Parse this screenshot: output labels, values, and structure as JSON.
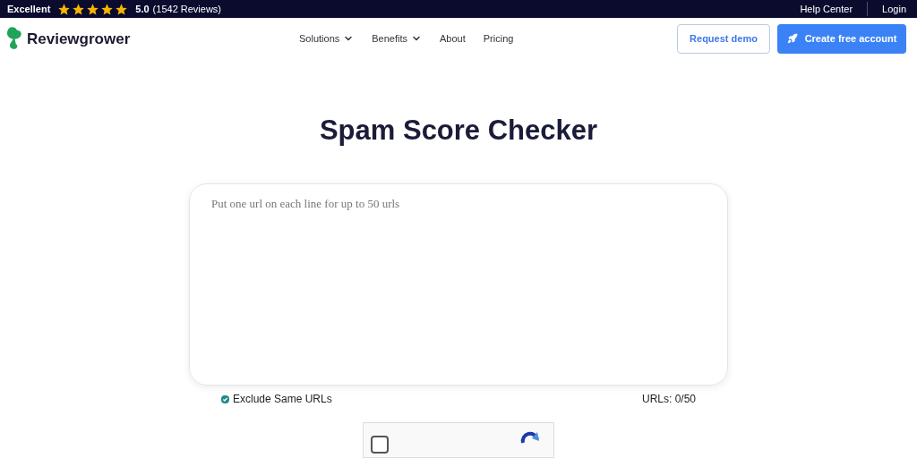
{
  "top_bar": {
    "rating_label": "Excellent",
    "stars": 5,
    "score": "5.0",
    "reviews": "(1542 Reviews)",
    "links": [
      "Help Center",
      "Login"
    ]
  },
  "header": {
    "logo": "Reviewgrower",
    "nav": [
      {
        "label": "Solutions",
        "dropdown": true
      },
      {
        "label": "Benefits",
        "dropdown": true
      },
      {
        "label": "About",
        "dropdown": false
      },
      {
        "label": "Pricing",
        "dropdown": false
      }
    ],
    "secondary_button": "Request demo",
    "primary_button": "Create free account"
  },
  "main": {
    "title": "Spam Score Checker",
    "url_field": {
      "placeholder": "Put one url on each line for up to 50 urls"
    },
    "exclude_checkbox": {
      "label": "Exclude Same URLs",
      "checked": true
    },
    "url_count": "URLs: 0/50",
    "captcha": {
      "checked": false
    }
  }
}
